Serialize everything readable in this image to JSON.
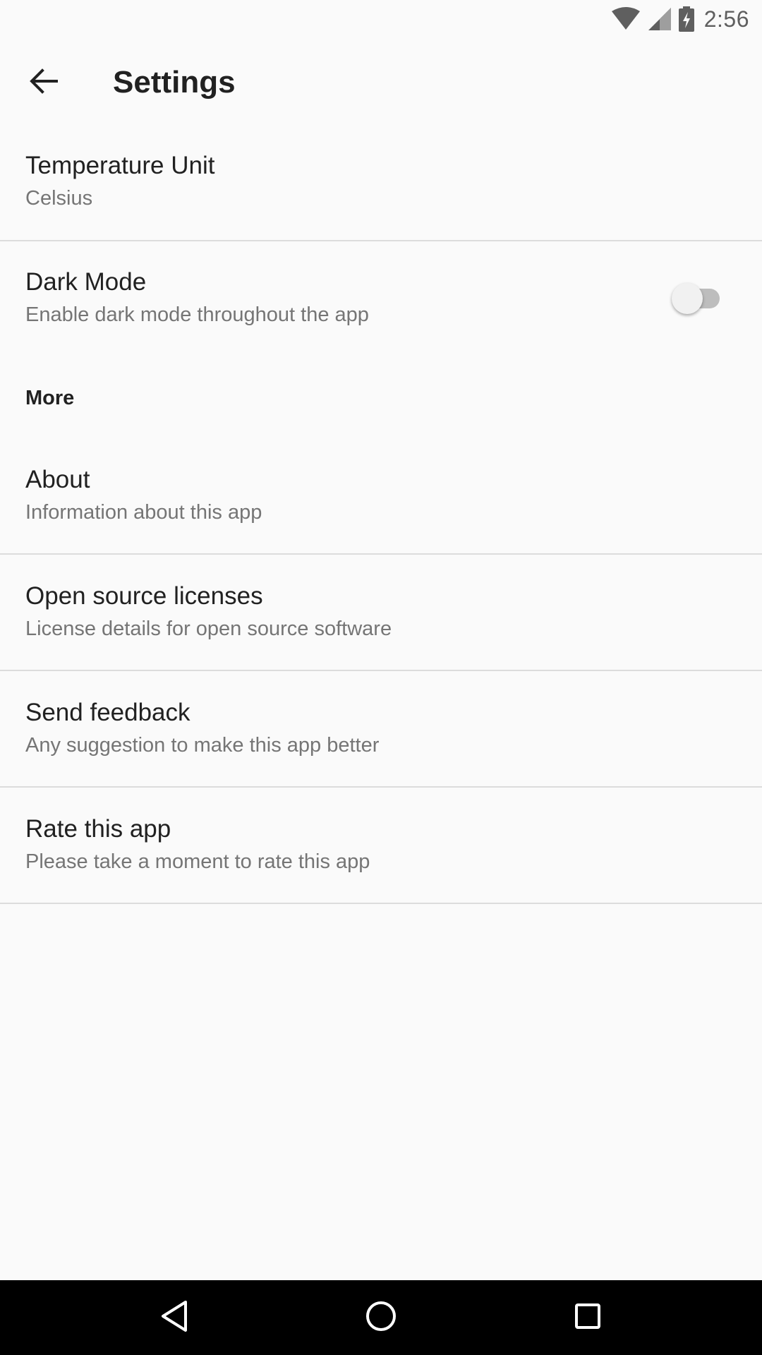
{
  "status_bar": {
    "time": "2:56",
    "icons": [
      "wifi-icon",
      "cell-signal-icon",
      "battery-charging-icon"
    ]
  },
  "toolbar": {
    "back_icon": "arrow-back-icon",
    "title": "Settings"
  },
  "preferences": [
    {
      "title": "Temperature Unit",
      "summary": "Celsius"
    },
    {
      "title": "Dark Mode",
      "summary": "Enable dark mode throughout the app",
      "switch_on": false
    }
  ],
  "category_more": "More",
  "more_items": [
    {
      "title": "About",
      "summary": "Information about this app"
    },
    {
      "title": "Open source licenses",
      "summary": "License details for open source software"
    },
    {
      "title": "Send feedback",
      "summary": "Any suggestion to make this app better"
    },
    {
      "title": "Rate this app",
      "summary": "Please take a moment to rate this app"
    }
  ],
  "nav_bar": {
    "icons": [
      "nav-back-icon",
      "nav-home-icon",
      "nav-recents-icon"
    ]
  },
  "colors": {
    "background": "#fafafa",
    "text_primary": "#212121",
    "text_secondary": "#757575",
    "divider": "#dcdcdc",
    "nav_bar": "#000000"
  }
}
